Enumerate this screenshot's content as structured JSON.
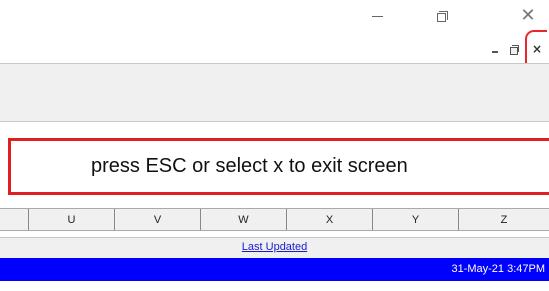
{
  "window": {
    "minimize_icon": "minimize-icon",
    "restore_icon": "restore-icon",
    "close_icon": "close-icon"
  },
  "mdi": {
    "minimize_icon": "minimize-icon",
    "restore_icon": "restore-icon",
    "close_label": "×",
    "highlight_color": "#e8262c"
  },
  "banner": {
    "text": "press ESC or select x to exit screen",
    "border_color": "#e0201e"
  },
  "columns": [
    "U",
    "V",
    "W",
    "X",
    "Y",
    "Z"
  ],
  "last_updated": {
    "label": "Last Updated",
    "link_color": "#1a1acc"
  },
  "status": {
    "datetime": "31-May-21 3:47PM",
    "background": "#0000ff"
  }
}
